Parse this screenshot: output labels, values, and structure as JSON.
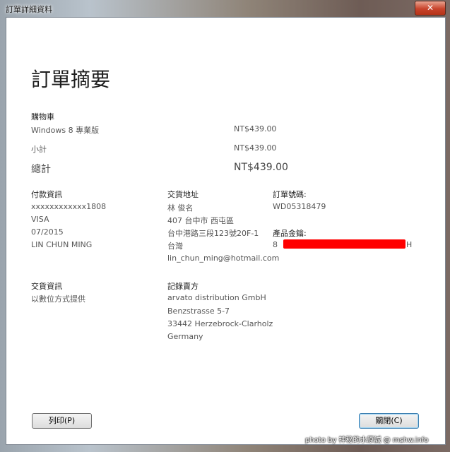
{
  "window": {
    "title": "訂單詳細資料",
    "close_label": "✕"
  },
  "heading": "訂單摘要",
  "cart": {
    "label": "購物車",
    "item_name": "Windows 8 專業版",
    "item_price": "NT$439.00",
    "subtotal_label": "小計",
    "subtotal_value": "NT$439.00",
    "total_label": "總計",
    "total_value": "NT$439.00"
  },
  "payment": {
    "label": "付款資訊",
    "card_number": "xxxxxxxxxxxx1808",
    "card_type": "VISA",
    "expiry": "07/2015",
    "name": "LIN CHUN MING"
  },
  "shipping": {
    "label": "交貨地址",
    "name": "林 俊名",
    "line1": "407 台中市 西屯區",
    "line2": "台中港路三段123號20F-1",
    "country": "台灣",
    "email": "lin_chun_ming@hotmail.com"
  },
  "order": {
    "number_label": "訂單號碼:",
    "number_value": "WD05318479",
    "key_label": "產品金鑰:",
    "key_prefix": "8",
    "key_suffix": "H"
  },
  "delivery": {
    "label": "交貨資訊",
    "value": "以數位方式提供"
  },
  "seller": {
    "label": "記錄賣方",
    "line1": "arvato distribution GmbH",
    "line2": "Benzstrasse 5-7",
    "line3": "33442 Herzebrock-Clarholz",
    "line4": "Germany"
  },
  "buttons": {
    "print": "列印(P)",
    "close": "關閉(C)"
  },
  "watermark": "photo by 神秘的水原誠 @ mshw.info",
  "colors": {
    "redaction": "#ff0000",
    "default_button_border": "#3c7fb1"
  }
}
